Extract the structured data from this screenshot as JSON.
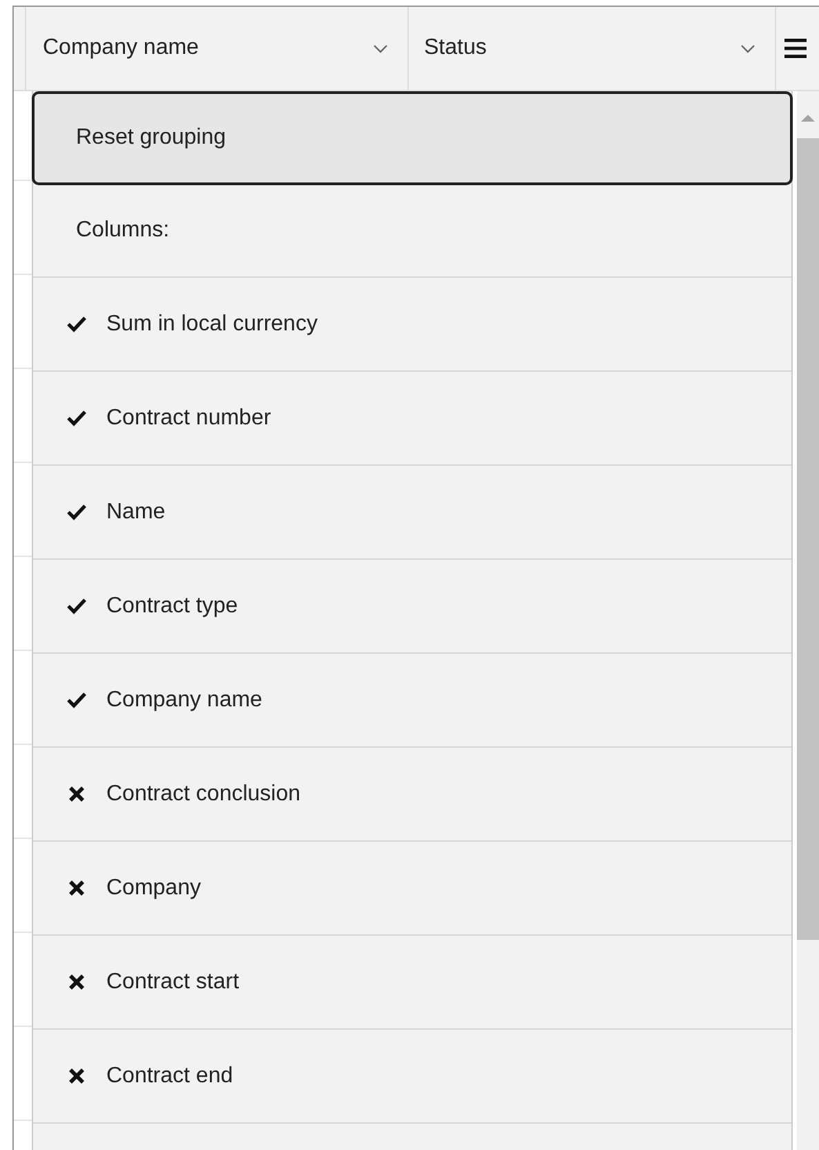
{
  "header": {
    "columns": [
      {
        "label": "Company name"
      },
      {
        "label": "Status"
      }
    ]
  },
  "menu": {
    "reset_label": "Reset grouping",
    "columns_label": "Columns:",
    "items": [
      {
        "label": "Sum in local currency",
        "checked": true
      },
      {
        "label": "Contract number",
        "checked": true
      },
      {
        "label": "Name",
        "checked": true
      },
      {
        "label": "Contract type",
        "checked": true
      },
      {
        "label": "Company name",
        "checked": true
      },
      {
        "label": "Contract conclusion",
        "checked": false
      },
      {
        "label": "Company",
        "checked": false
      },
      {
        "label": "Contract start",
        "checked": false
      },
      {
        "label": "Contract end",
        "checked": false
      }
    ]
  }
}
